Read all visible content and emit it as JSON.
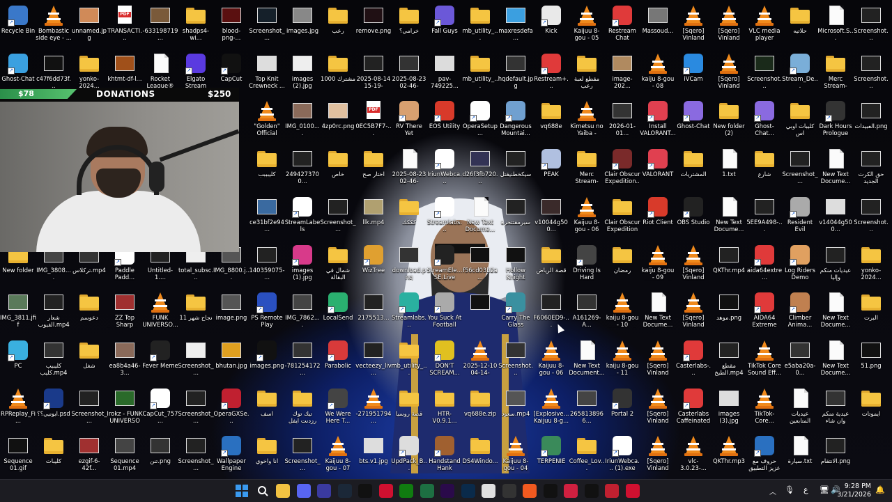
{
  "icons": [
    {
      "label": "Recycle Bin",
      "type": "app",
      "color": "#3a78c9"
    },
    {
      "label": "Bombastic side eye - ...",
      "type": "vlc"
    },
    {
      "label": "unnamed.jpg",
      "type": "img",
      "color": "#d08a58"
    },
    {
      "label": "TRANSACTI...",
      "type": "pdf"
    },
    {
      "label": "-633198719...",
      "type": "img",
      "color": "#7a5a3a"
    },
    {
      "label": "shadps4-wi...",
      "type": "folder"
    },
    {
      "label": "blood-png-...",
      "type": "img",
      "color": "#5a1010"
    },
    {
      "label": "Screenshot_...",
      "type": "img",
      "color": "#15202a"
    },
    {
      "label": "images.jpg",
      "type": "img",
      "color": "#888"
    },
    {
      "label": "رعب",
      "type": "folder"
    },
    {
      "label": "remove.png",
      "type": "img",
      "color": "#201014"
    },
    {
      "label": "خرامي؟",
      "type": "folder"
    },
    {
      "label": "Fall Guys",
      "type": "app",
      "color": "#6b58d8"
    },
    {
      "label": "mb_utility_...",
      "type": "folder"
    },
    {
      "label": "maxresdefa...",
      "type": "img",
      "color": "#3b9fe0"
    },
    {
      "label": "Kick",
      "type": "app",
      "color": "#e9e9e9"
    },
    {
      "label": "Kaijuu 8-gou - 05 (4K).mp4",
      "type": "vlc"
    },
    {
      "label": "Restream Chat",
      "type": "app",
      "color": "#e03a3a"
    },
    {
      "label": "Massoud...",
      "type": "img",
      "color": "#777"
    },
    {
      "label": "[Sqero] Vinland Sa...",
      "type": "vlc"
    },
    {
      "label": "[Sqero] Vinland Sa...",
      "type": "vlc"
    },
    {
      "label": "VLC media player",
      "type": "vlc"
    },
    {
      "label": "حلاتيه",
      "type": "folder"
    },
    {
      "label": "Microsoft.S...",
      "type": "doc"
    },
    {
      "label": "Screenshot...",
      "type": "img",
      "color": "#222"
    },
    {
      "label": "Ghost-Chat",
      "type": "app",
      "color": "#3aa0e0"
    },
    {
      "label": "c47f6dd73f...",
      "type": "img",
      "color": "#111"
    },
    {
      "label": "yonko-2024...",
      "type": "folder"
    },
    {
      "label": "khtmt-df-l...",
      "type": "img",
      "color": "#a0501a"
    },
    {
      "label": "Rocket League®",
      "type": "doc"
    },
    {
      "label": "Elgato Stream Deck",
      "type": "app",
      "color": "#5a3ae0"
    },
    {
      "label": "CapCut",
      "type": "app",
      "color": "#111"
    },
    {
      "label": "Top Knit Crewneck ...",
      "type": "img",
      "color": "#ddd"
    },
    {
      "label": "images (2).jpg",
      "type": "img",
      "color": "#eee"
    },
    {
      "label": "مشترك 1000",
      "type": "folder"
    },
    {
      "label": "2025-08-14 15-19-27.00...",
      "type": "img",
      "color": "#222"
    },
    {
      "label": "2025-08-23 02-46-58.00...",
      "type": "img",
      "color": "#333"
    },
    {
      "label": "pav-749225...",
      "type": "img",
      "color": "#dcdcdc"
    },
    {
      "label": "mb_utility_...",
      "type": "folder"
    },
    {
      "label": "hqdefault.jpg",
      "type": "img",
      "color": "#333"
    },
    {
      "label": "Restream+...",
      "type": "app",
      "color": "#e03a3a"
    },
    {
      "label": "مقطع لعبة رعب",
      "type": "folder"
    },
    {
      "label": "image-202...",
      "type": "img",
      "color": "#b08a60"
    },
    {
      "label": "kaiju 8-gou - 08 (4K).mp4",
      "type": "vlc"
    },
    {
      "label": "iVCam",
      "type": "app",
      "color": "#2a8ae0"
    },
    {
      "label": "[Sqero] Vinland Sa...",
      "type": "vlc"
    },
    {
      "label": "Screenshot...",
      "type": "img",
      "color": "#1a2a1a"
    },
    {
      "label": "Stream_De...",
      "type": "app",
      "color": "#7aaed8"
    },
    {
      "label": "Merc Stream-202...",
      "type": "folder"
    },
    {
      "label": "Screenshot...",
      "type": "img",
      "color": "#222"
    },
    {
      "label": "\"Golden\" Official Lyri...",
      "type": "vlc"
    },
    {
      "label": "IMG_0100....",
      "type": "img",
      "color": "#8a6a5a"
    },
    {
      "label": "4zp0rc.png",
      "type": "img",
      "color": "#e0c0a0"
    },
    {
      "label": "0EC5B7F7-...",
      "type": "pdf"
    },
    {
      "label": "RV There Yet",
      "type": "app",
      "color": "#d8a070"
    },
    {
      "label": "EOS Utility",
      "type": "app",
      "color": "#d83a2a"
    },
    {
      "label": "OperaSetup...",
      "type": "app",
      "color": "#fff"
    },
    {
      "label": "Dangerous Mountai...",
      "type": "app",
      "color": "#70a0d0"
    },
    {
      "label": "vq688e",
      "type": "folder"
    },
    {
      "label": "Kimetsu no Yaiba - Mov...",
      "type": "vlc"
    },
    {
      "label": "2026-01-01...",
      "type": "img",
      "color": "#333"
    },
    {
      "label": "Install VALORANT...",
      "type": "app",
      "color": "#e04050"
    },
    {
      "label": "Ghost-Chat",
      "type": "app",
      "color": "#8a6ae0"
    },
    {
      "label": "New folder (2)",
      "type": "folder"
    },
    {
      "label": "Ghost-Chat...",
      "type": "app",
      "color": "#8a6ae0"
    },
    {
      "label": "كليبات اوبي اس",
      "type": "folder"
    },
    {
      "label": "Dark Hours Prologue",
      "type": "app",
      "color": "#333"
    },
    {
      "label": "العبيدات.png",
      "type": "img",
      "color": "#222"
    },
    {
      "label": "كليبببب",
      "type": "folder"
    },
    {
      "label": "2494273700...",
      "type": "img",
      "color": "#222"
    },
    {
      "label": "خاص",
      "type": "folder"
    },
    {
      "label": "اختار صح",
      "type": "folder"
    },
    {
      "label": "2025-08-23 02-46-58.00...",
      "type": "doc"
    },
    {
      "label": "IriunWebca...",
      "type": "app",
      "color": "#fff"
    },
    {
      "label": "d26f3fb720...",
      "type": "img",
      "color": "#335"
    },
    {
      "label": "سيكخطنيقتل",
      "type": "img",
      "color": "#222"
    },
    {
      "label": "PEAK",
      "type": "app",
      "color": "#b0c0e0"
    },
    {
      "label": "Merc Stream-202...",
      "type": "folder"
    },
    {
      "label": "Clair Obscur Expedition...",
      "type": "app",
      "color": "#7a2a2a"
    },
    {
      "label": "VALORANT",
      "type": "app",
      "color": "#e04050"
    },
    {
      "label": "المشتريات",
      "type": "folder"
    },
    {
      "label": "1.txt",
      "type": "doc"
    },
    {
      "label": "شارع",
      "type": "folder"
    },
    {
      "label": "Screenshot_...",
      "type": "img",
      "color": "#222"
    },
    {
      "label": "New Text Docume...",
      "type": "doc"
    },
    {
      "label": "حق الكرت الجديد",
      "type": "img",
      "color": "#222"
    },
    {
      "label": "ce31bf2e94...",
      "type": "img",
      "color": "#3a6aa0"
    },
    {
      "label": "StreamLabels",
      "type": "app",
      "color": "#fff"
    },
    {
      "label": "Screenshot_...",
      "type": "img",
      "color": "#222"
    },
    {
      "label": "llk.mp4",
      "type": "img",
      "color": "#b0a070"
    },
    {
      "label": "كككك",
      "type": "folder"
    },
    {
      "label": "Streamlabs...",
      "type": "app",
      "color": "#fff"
    },
    {
      "label": "New Text Docume...",
      "type": "doc"
    },
    {
      "label": "سيرمقتتخرة",
      "type": "img",
      "color": "#222"
    },
    {
      "label": "v10044g500...",
      "type": "img",
      "color": "#3a2a2a"
    },
    {
      "label": "Kaijuu 8-gou - 06 (4K).mp4",
      "type": "vlc"
    },
    {
      "label": "Clair Obscur Expedition 33",
      "type": "folder"
    },
    {
      "label": "Riot Client",
      "type": "app",
      "color": "#d83a2a"
    },
    {
      "label": "OBS Studio",
      "type": "app",
      "color": "#222"
    },
    {
      "label": "New Text Docume...",
      "type": "doc"
    },
    {
      "label": "5EE9A498-...",
      "type": "img",
      "color": "#222"
    },
    {
      "label": "Resident Evil Requiem",
      "type": "app",
      "color": "#aaa"
    },
    {
      "label": "v14044g500...",
      "type": "img",
      "color": "#ddd"
    },
    {
      "label": "Screenshot...",
      "type": "img",
      "color": "#222"
    },
    {
      "label": "New folder",
      "type": "folder"
    },
    {
      "label": "IMG_3808....",
      "type": "img",
      "color": "#444"
    },
    {
      "label": "تركلاس.mp4",
      "type": "img",
      "color": "#333"
    },
    {
      "label": "Paddle Padd...",
      "type": "app",
      "color": "#fff"
    },
    {
      "label": "Untitled-1....",
      "type": "img",
      "color": "#222"
    },
    {
      "label": "total_subsc...",
      "type": "img",
      "color": "#eee"
    },
    {
      "label": "IMG_8800.j...",
      "type": "img",
      "color": "#555"
    },
    {
      "label": "140359075-...",
      "type": "img",
      "color": "#222"
    },
    {
      "label": "images (1).jpg",
      "type": "app",
      "color": "#d83a8a"
    },
    {
      "label": "شمال في البقالة",
      "type": "folder"
    },
    {
      "label": "WizTree",
      "type": "app",
      "color": "#e0a030"
    },
    {
      "label": "download.png",
      "type": "img",
      "color": "#333"
    },
    {
      "label": "StreamEle... SE.Live",
      "type": "app",
      "color": "#222"
    },
    {
      "label": "f56cd03b2a...",
      "type": "img",
      "color": "#111"
    },
    {
      "label": "Hollow Knight",
      "type": "img",
      "color": "#111"
    },
    {
      "label": "قصة الرياض",
      "type": "folder"
    },
    {
      "label": "Driving Is Hard",
      "type": "app",
      "color": "#444"
    },
    {
      "label": "رمضان",
      "type": "folder"
    },
    {
      "label": "kaiju 8-gou - 09 (4K).mp4",
      "type": "vlc"
    },
    {
      "label": "[Sqero] Vinland Sa...",
      "type": "vlc"
    },
    {
      "label": "QKThr.mp4",
      "type": "img",
      "color": "#222"
    },
    {
      "label": "aida64extre...",
      "type": "app",
      "color": "#e03a3a"
    },
    {
      "label": "Log Riders Demo",
      "type": "app",
      "color": "#e0a060"
    },
    {
      "label": "عيديات منكم وإليا",
      "type": "img",
      "color": "#222"
    },
    {
      "label": "yonko-2024...",
      "type": "folder"
    },
    {
      "label": "IMG_3811.jfif",
      "type": "img",
      "color": "#5a7a5a"
    },
    {
      "label": "شعار الفيوب.mp4",
      "type": "img",
      "color": "#222"
    },
    {
      "label": "دعوسم",
      "type": "folder"
    },
    {
      "label": "ZZ Top Sharp Dressed M...",
      "type": "img",
      "color": "#a03030"
    },
    {
      "label": "FUNK UNIVERSO...",
      "type": "vlc"
    },
    {
      "label": "نجاح شهر 11",
      "type": "folder"
    },
    {
      "label": "image.png",
      "type": "img",
      "color": "#555"
    },
    {
      "label": "PS Remote Play",
      "type": "app",
      "color": "#2a50c0"
    },
    {
      "label": "IMG_7862....",
      "type": "img",
      "color": "#444"
    },
    {
      "label": "LocalSend",
      "type": "app",
      "color": "#2ab070"
    },
    {
      "label": "2175513...",
      "type": "img",
      "color": "#222"
    },
    {
      "label": "Streamlabs...",
      "type": "app",
      "color": "#2ab0a0"
    },
    {
      "label": "You Suck At Football",
      "type": "app",
      "color": "#aaa"
    },
    {
      "label": "",
      "type": "img",
      "color": "#111"
    },
    {
      "label": "Carry The Glass",
      "type": "app",
      "color": "#3a90a0"
    },
    {
      "label": "F6060ED9-...",
      "type": "img",
      "color": "#222"
    },
    {
      "label": "A161269-A...",
      "type": "img",
      "color": "#333"
    },
    {
      "label": "kaiju 8-gou - 10 (4K).mp4",
      "type": "vlc"
    },
    {
      "label": "New Text Docume...",
      "type": "doc"
    },
    {
      "label": "[Sqero] Vinland Sa...",
      "type": "vlc"
    },
    {
      "label": "موهد.png",
      "type": "img",
      "color": "#111"
    },
    {
      "label": "AIDA64 Extreme",
      "type": "app",
      "color": "#e03a3a"
    },
    {
      "label": "Climber Anima...",
      "type": "app",
      "color": "#c08050"
    },
    {
      "label": "New Text Docume...",
      "type": "doc"
    },
    {
      "label": "البرت",
      "type": "folder"
    },
    {
      "label": "PC",
      "type": "app",
      "color": "#3ab0e0"
    },
    {
      "label": "كليبيب كليب.mp4",
      "type": "img",
      "color": "#333"
    },
    {
      "label": "شغل",
      "type": "folder"
    },
    {
      "label": "ea8b4a46-3...",
      "type": "img",
      "color": "#8a6a5a"
    },
    {
      "label": "Fever Meme",
      "type": "app",
      "color": "#222"
    },
    {
      "label": "Screenshot_...",
      "type": "img",
      "color": "#eee"
    },
    {
      "label": "bhutan.jpg",
      "type": "img",
      "color": "#e0a020"
    },
    {
      "label": "images.png",
      "type": "app",
      "color": "#111"
    },
    {
      "label": "-781254172...",
      "type": "img",
      "color": "#333"
    },
    {
      "label": "Parabolic",
      "type": "app",
      "color": "#d83a3a"
    },
    {
      "label": "vecteezy_liv...",
      "type": "img",
      "color": "#222"
    },
    {
      "label": "mb_utility_...",
      "type": "folder"
    },
    {
      "label": "DON'T SCREAM...",
      "type": "app",
      "color": "#e0c020"
    },
    {
      "label": "2025-12-10 04-14-57.mkv",
      "type": "vlc"
    },
    {
      "label": "Screenshot...",
      "type": "img",
      "color": "#333"
    },
    {
      "label": "Kaijuu 8-gou - 06 (4K) (1...",
      "type": "vlc"
    },
    {
      "label": "New Text Document...",
      "type": "doc"
    },
    {
      "label": "kaiju 8-gou - 11 (4K).mp4",
      "type": "vlc"
    },
    {
      "label": "[Sqero] Vinland Sa...",
      "type": "vlc"
    },
    {
      "label": "Casterlabs-...",
      "type": "app",
      "color": "#e03a3a"
    },
    {
      "label": "مقطع الطبخ.mp4",
      "type": "img",
      "color": "#222"
    },
    {
      "label": "TikTok Core Sound Eff...",
      "type": "vlc"
    },
    {
      "label": "e5aba20a-0...",
      "type": "img",
      "color": "#333"
    },
    {
      "label": "New Text Docume...",
      "type": "doc"
    },
    {
      "label": "51.png",
      "type": "img",
      "color": "#111"
    },
    {
      "label": "RPReplay_Fi...",
      "type": "vlc"
    },
    {
      "label": "ابونيي؟؟.psd",
      "type": "app",
      "color": "#1a3a8a"
    },
    {
      "label": "Screenshot_...",
      "type": "img",
      "color": "#222"
    },
    {
      "label": "Irokz - FUNK UNIVERSO [...",
      "type": "img",
      "color": "#2a6a2a"
    },
    {
      "label": "CapCut_757...",
      "type": "app",
      "color": "#fff"
    },
    {
      "label": "Screenshot_...",
      "type": "img",
      "color": "#222"
    },
    {
      "label": "OperaGXSe...",
      "type": "app",
      "color": "#c02030"
    },
    {
      "label": "اسف",
      "type": "folder"
    },
    {
      "label": "تيك توك رزدنت ايفل",
      "type": "folder"
    },
    {
      "label": "We Were Here T...",
      "type": "app",
      "color": "#444"
    },
    {
      "label": "-271951794...",
      "type": "vlc"
    },
    {
      "label": "قصة روسيا",
      "type": "folder"
    },
    {
      "label": "HTR-V0.9.1...",
      "type": "folder"
    },
    {
      "label": "vq688e.zip",
      "type": "folder"
    },
    {
      "label": "سعود.mp4",
      "type": "img",
      "color": "#555"
    },
    {
      "label": "[Explosive... Kaijuu 8-g...",
      "type": "vlc"
    },
    {
      "label": "2658138966...",
      "type": "img",
      "color": "#444"
    },
    {
      "label": "Portal 2",
      "type": "app",
      "color": "#333"
    },
    {
      "label": "[Sqero] Vinland Sa...",
      "type": "vlc"
    },
    {
      "label": "Casterlabs Caffeinated",
      "type": "app",
      "color": "#e03a3a"
    },
    {
      "label": "images (3).jpg",
      "type": "img",
      "color": "#ddd"
    },
    {
      "label": "TikTok-Core...",
      "type": "vlc"
    },
    {
      "label": "عيديات المتابعين",
      "type": "doc"
    },
    {
      "label": "عيدية منكم وان شاء",
      "type": "img",
      "color": "#333"
    },
    {
      "label": "ايموتات",
      "type": "folder"
    },
    {
      "label": "Sequence 01.gif",
      "type": "img",
      "color": "#111"
    },
    {
      "label": "كليبات",
      "type": "folder"
    },
    {
      "label": "ezgif-6-42f...",
      "type": "img",
      "color": "#a03030"
    },
    {
      "label": "Sequence 01.mp4",
      "type": "img",
      "color": "#444"
    },
    {
      "label": "تنن.png",
      "type": "img",
      "color": "#333"
    },
    {
      "label": "Screenshot_...",
      "type": "img",
      "color": "#222"
    },
    {
      "label": "Wallpaper Engine",
      "type": "app",
      "color": "#2a70c0"
    },
    {
      "label": "انا واخوي",
      "type": "folder"
    },
    {
      "label": "Screenshot_...",
      "type": "img",
      "color": "#222"
    },
    {
      "label": "Kaijuu 8-gou - 07 (4K).mp4",
      "type": "vlc"
    },
    {
      "label": "bts.v1.jpg",
      "type": "img",
      "color": "#ddd"
    },
    {
      "label": "UpdPack_B...",
      "type": "app",
      "color": "#ddd"
    },
    {
      "label": "Handstand Hank",
      "type": "app",
      "color": "#a06030"
    },
    {
      "label": "DS4Windo...",
      "type": "folder"
    },
    {
      "label": "Kaijuu 8-gou - 04 (4K).mp4",
      "type": "vlc"
    },
    {
      "label": "TERPENIE",
      "type": "app",
      "color": "#3a8a5a"
    },
    {
      "label": "Coffee_Lov...",
      "type": "folder"
    },
    {
      "label": "IriunWebca... (1).exe",
      "type": "app",
      "color": "#fff"
    },
    {
      "label": "[Sqero] Vinland Sa...",
      "type": "vlc"
    },
    {
      "label": "vlc-3.0.23-...",
      "type": "vlc"
    },
    {
      "label": "QKThr.mp3",
      "type": "vlc"
    },
    {
      "label": "حروف مع عزيز التطبيق الر...",
      "type": "app",
      "color": "#2a70c0"
    },
    {
      "label": "سيارة.txt",
      "type": "doc"
    },
    {
      "label": "الانتقام.png",
      "type": "img",
      "color": "#222"
    }
  ],
  "donations": {
    "left_amount": "$78",
    "title": "DONATIONS",
    "right_amount": "$250"
  },
  "taskbar": {
    "apps": [
      "start",
      "search",
      "file-explorer",
      "discord",
      "media",
      "steam",
      "capcut",
      "opera-gx",
      "xbox",
      "excel",
      "premiere",
      "photoshop",
      "chrome",
      "obs",
      "brave",
      "capcut2",
      "clipchamp",
      "rec",
      "capture",
      "opera"
    ],
    "time": "9:28 PM",
    "date": "3/21/2026",
    "lang": "ع"
  }
}
